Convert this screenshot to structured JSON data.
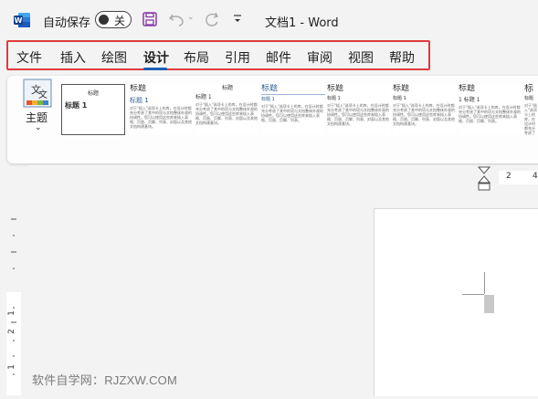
{
  "titlebar": {
    "autosave_label": "自动保存",
    "autosave_state": "关",
    "doc_title": "文档1  -  Word",
    "icons": [
      "word-logo",
      "save-icon",
      "undo-icon",
      "redo-icon",
      "customize-quick-access-icon"
    ]
  },
  "tabs": [
    {
      "label": "文件",
      "active": false
    },
    {
      "label": "插入",
      "active": false
    },
    {
      "label": "绘图",
      "active": false
    },
    {
      "label": "设计",
      "active": true
    },
    {
      "label": "布局",
      "active": false
    },
    {
      "label": "引用",
      "active": false
    },
    {
      "label": "邮件",
      "active": false
    },
    {
      "label": "审阅",
      "active": false
    },
    {
      "label": "视图",
      "active": false
    },
    {
      "label": "帮助",
      "active": false
    }
  ],
  "ribbon": {
    "themes_label": "主题",
    "styles": [
      {
        "title": "标题",
        "heading": "标题 1",
        "body": "",
        "selected": true
      },
      {
        "title": "标题",
        "heading": "标题 1",
        "body": "对于\"插入\"选项卡上的库，在设计时都充分考虑了其中的项与文档整体外观的协调性。您可以使用这些库来插入表格、页眉、页脚、列表、封面以及其他文档构建基块。",
        "selected": false
      },
      {
        "title": "标题",
        "heading": "标题 1",
        "body": "对于\"插入\"选项卡上的库，在设计时都充分考虑了其中的项与文档整体外观的协调性。您可以使用这些库来插入表格、页眉、页脚、列表、封面以及其他文档构建基块。",
        "selected": false
      },
      {
        "title": "标题",
        "heading": "标题 1",
        "body": "对于\"插入\"选项卡上的库，在设计时都充分考虑了其中的项与文档整体外观的协调性。您可以使用这些库来插入表格、页眉、页脚、列表。",
        "selected": false
      },
      {
        "title": "标题",
        "heading": "标题 1",
        "body": "对于\"插入\"选项卡上的库，在设计时都充分考虑了其中的项与文档整体外观的协调性。您可以使用这些库来插入表格、页眉、页脚、列表、封面以及其他文档构建基块。",
        "selected": false
      },
      {
        "title": "标题",
        "heading": "标题 1",
        "body": "对于\"插入\"选项卡上的库，在设计时都充分考虑了其中的项与文档整体外观的协调性。您可以使用这些库来插入表格、页眉、页脚、列表、封面以及其他文档构建基块。",
        "selected": false
      },
      {
        "title": "标题",
        "heading": "1 标题 1",
        "body": "对于\"插入\"选项卡上的库，在设计时都充分考虑了其中的项与文档整体外观的协调性。您可以使用这些库来插入表格、页眉、页脚、列表。",
        "selected": false
      },
      {
        "title": "标",
        "heading": "标题",
        "body": "对于\"插入\"选项卡上的库，在设计时都充分考虑了其中的项与文档整体外观的协调性。",
        "selected": false
      }
    ]
  },
  "ruler": {
    "top_numbers": [
      "2",
      "4"
    ],
    "side_numbers": [
      "1",
      "2",
      "1"
    ]
  },
  "watermark": "软件自学网：RJZXW.COM",
  "colors": {
    "accent": "#1a5fb4",
    "highlight_box": "#e03b3b",
    "word_blue": "#185abd",
    "save_purple": "#8a3aa8"
  }
}
